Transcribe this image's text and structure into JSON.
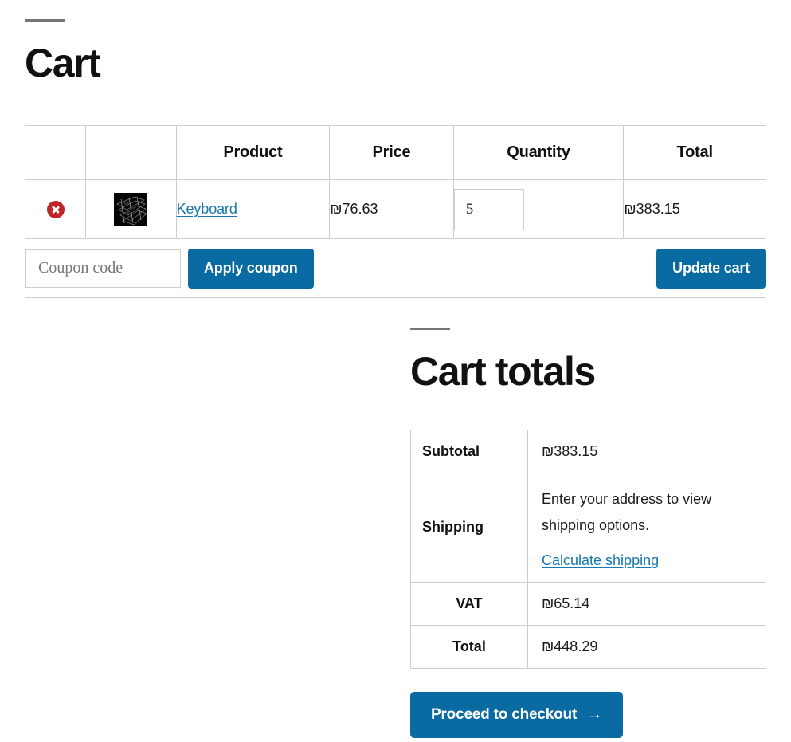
{
  "page": {
    "title": "Cart",
    "accent_color": "#0a6ba3",
    "link_color": "#1578ae",
    "remove_color": "#c0252a",
    "border_color": "#cdcdcd",
    "rule_color": "#767676"
  },
  "cart_table": {
    "headers": [
      "",
      "",
      "Product",
      "Price",
      "Quantity",
      "Total"
    ],
    "rows": [
      {
        "remove_label": "×",
        "thumbnail_alt": "keyboard-thumbnail",
        "product": "Keyboard",
        "price": "₪76.63",
        "quantity": "5",
        "total": "₪383.15"
      }
    ]
  },
  "coupon": {
    "placeholder": "Coupon code",
    "value": "",
    "apply_label": "Apply coupon",
    "update_label": "Update cart"
  },
  "totals": {
    "heading": "Cart totals",
    "rows": [
      {
        "label": "Subtotal",
        "value": "₪383.15"
      },
      {
        "label": "Shipping",
        "value": ""
      },
      {
        "label": "VAT",
        "value": "₪65.14"
      },
      {
        "label": "Total",
        "value": "₪448.29"
      }
    ],
    "shipping": {
      "label": "Shipping",
      "message": "Enter your address to view shipping options.",
      "link_label": "Calculate shipping"
    },
    "subtotal_label": "Subtotal",
    "subtotal_value": "₪383.15",
    "vat_label": "VAT",
    "vat_value": "₪65.14",
    "total_label": "Total",
    "total_value": "₪448.29",
    "checkout_label": "Proceed to checkout",
    "checkout_arrow": "→"
  }
}
